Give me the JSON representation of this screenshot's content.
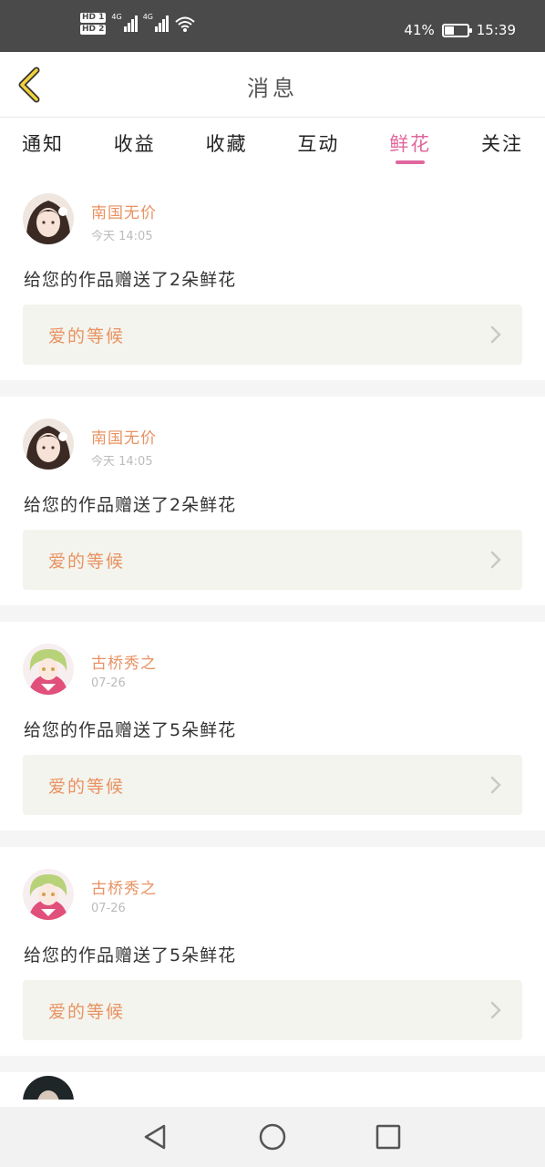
{
  "status_bar": {
    "hd1": "HD 1",
    "hd2": "HD 2",
    "net1": "4G",
    "net2": "4G",
    "battery_percent": "41%",
    "battery_level": 0.41,
    "time": "15:39"
  },
  "header": {
    "title": "消息",
    "back_icon": "chevron-left-icon"
  },
  "tabs": [
    {
      "label": "通知",
      "active": false
    },
    {
      "label": "收益",
      "active": false
    },
    {
      "label": "收藏",
      "active": false
    },
    {
      "label": "互动",
      "active": false
    },
    {
      "label": "鲜花",
      "active": true
    },
    {
      "label": "关注",
      "active": false
    }
  ],
  "messages": [
    {
      "user": "南国无价",
      "time": "今天 14:05",
      "text": "给您的作品赠送了2朵鲜花",
      "work": "爱的等候",
      "avatar": "dark-hair"
    },
    {
      "user": "南国无价",
      "time": "今天 14:05",
      "text": "给您的作品赠送了2朵鲜花",
      "work": "爱的等候",
      "avatar": "dark-hair"
    },
    {
      "user": "古桥秀之",
      "time": "07-26",
      "text": "给您的作品赠送了5朵鲜花",
      "work": "爱的等候",
      "avatar": "green-hair"
    },
    {
      "user": "古桥秀之",
      "time": "07-26",
      "text": "给您的作品赠送了5朵鲜花",
      "work": "爱的等候",
      "avatar": "green-hair"
    }
  ],
  "colors": {
    "accent_pink": "#e0679d",
    "username_orange": "#e89262",
    "status_bar_bg": "#4a4a4a",
    "card_button_bg": "#f4f4ee"
  },
  "nav": {
    "back": "triangle-back-icon",
    "home": "circle-home-icon",
    "recent": "square-recent-icon"
  }
}
